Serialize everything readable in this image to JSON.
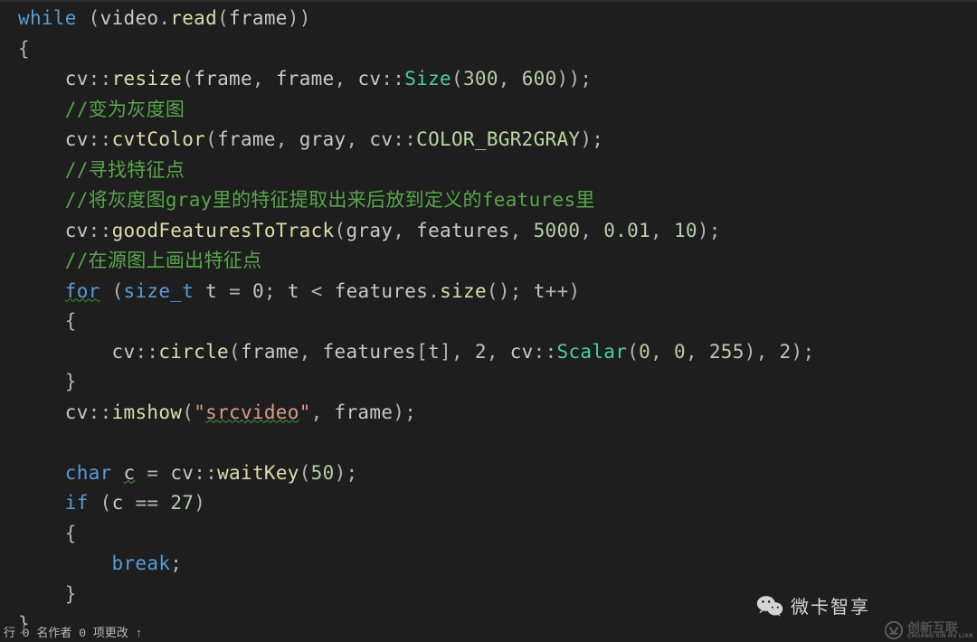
{
  "code": {
    "while_kw": "while",
    "video": "video",
    "read_fn": "read",
    "frame": "frame",
    "gray": "gray",
    "features_var": "features",
    "cv_ns": "cv",
    "resize_fn": "resize",
    "size_cls": "Size",
    "size_w": "300",
    "size_h": "600",
    "cmt_gray": "//变为灰度图",
    "cvtColor_fn": "cvtColor",
    "color_enum": "COLOR_BGR2GRAY",
    "cmt_find": "//寻找特征点",
    "cmt_extract": "//将灰度图gray里的特征提取出来后放到定义的features里",
    "good_fn": "goodFeaturesToTrack",
    "gf_p1": "5000",
    "gf_p2": "0.01",
    "gf_p3": "10",
    "cmt_draw": "//在源图上画出特征点",
    "for_kw": "for",
    "size_t": "size_t",
    "t_var": "t",
    "zero": "0",
    "size_fn": "size",
    "circle_fn": "circle",
    "circle_r": "2",
    "scalar_cls": "Scalar",
    "sc_b": "0",
    "sc_g": "0",
    "sc_r": "255",
    "circle_th": "2",
    "imshow_fn": "imshow",
    "srcvideo": "srcvideo",
    "char_kw": "char",
    "c_var": "c",
    "waitKey_fn": "waitKey",
    "wait_ms": "50",
    "if_kw": "if",
    "esc": "27",
    "break_kw": "break"
  },
  "status": "行 0  名作者    0  项更改    ↑",
  "watermark": {
    "wechat": "微卡智享",
    "brand": "创新互联",
    "brand_sub": "CHUANG XIN HU LIAN"
  }
}
